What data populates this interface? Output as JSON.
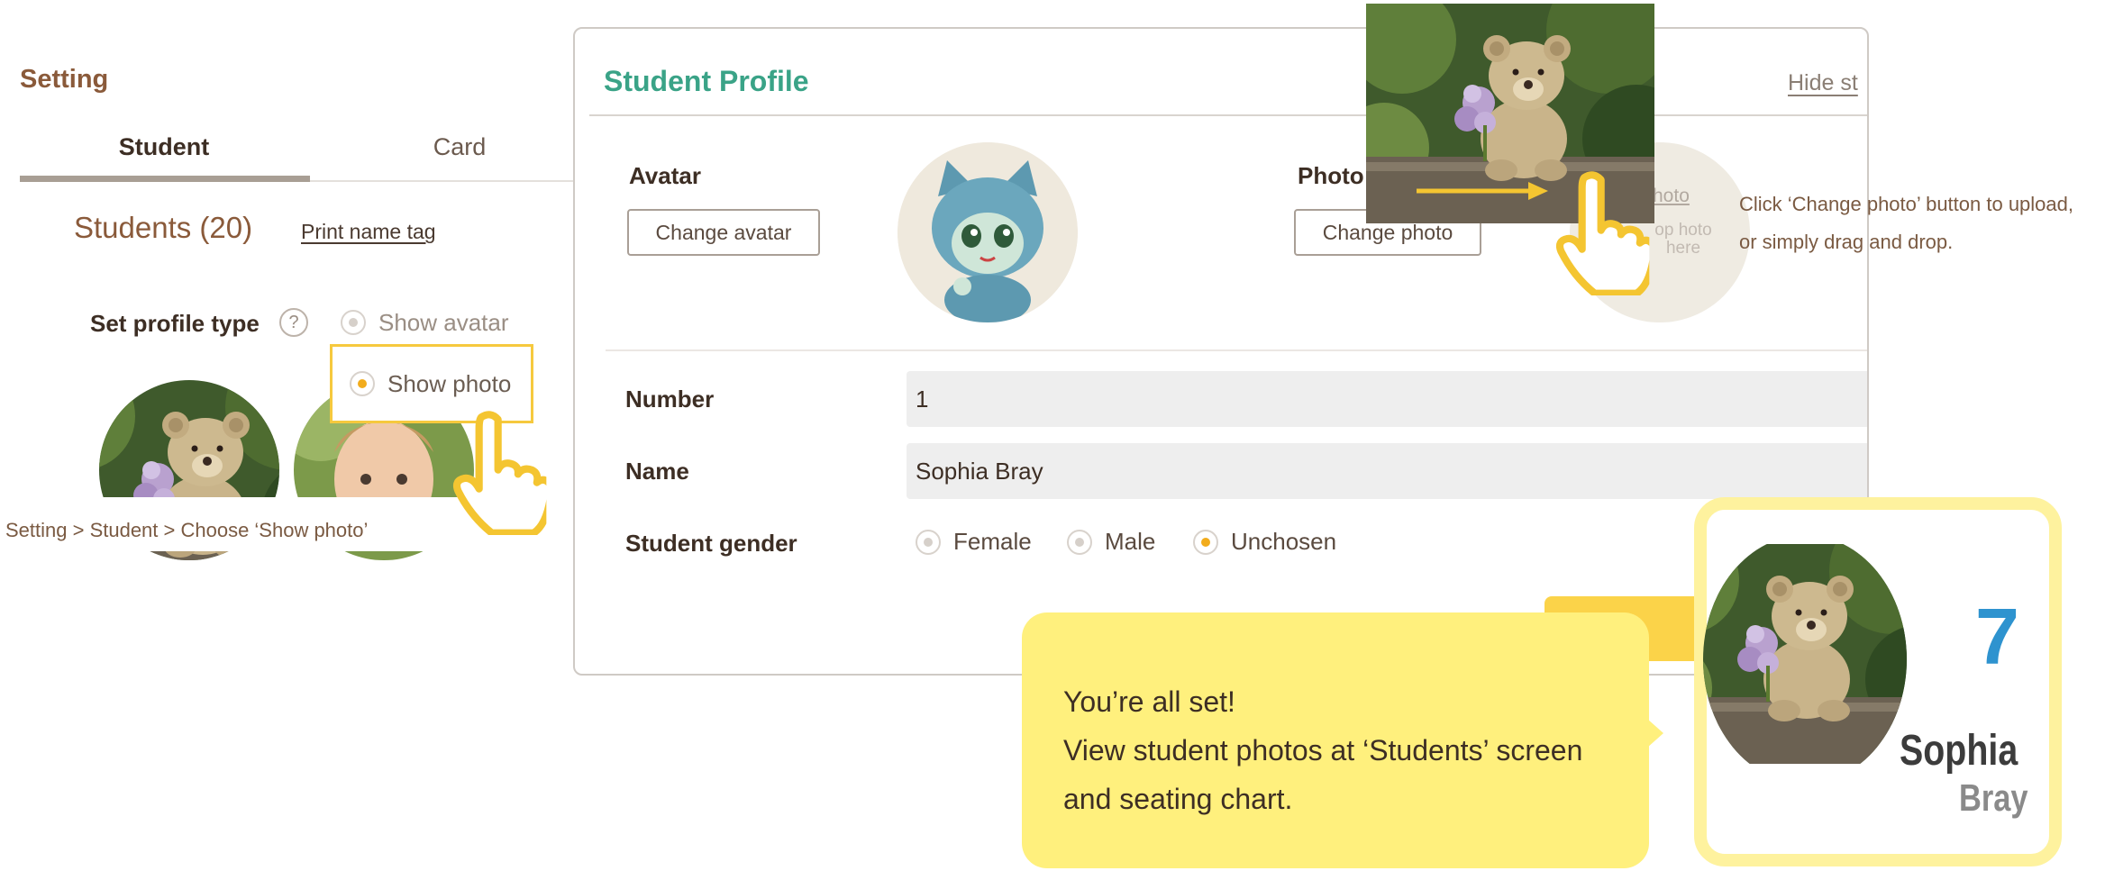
{
  "settings": {
    "title": "Setting",
    "tabs": [
      {
        "label": "Student",
        "active": true
      },
      {
        "label": "Card",
        "active": false
      }
    ],
    "students_heading": "Students (20)",
    "print_name_tag": "Print name tag",
    "profile_type_label": "Set profile type",
    "help_glyph": "?",
    "profile_options": [
      {
        "label": "Show avatar",
        "selected": false
      },
      {
        "label": "Show photo",
        "selected": true
      }
    ],
    "caption": "Setting > Student > Choose ‘Show photo’"
  },
  "modal": {
    "title": "Student Profile",
    "hide_link": "Hide st",
    "avatar_label": "Avatar",
    "change_avatar": "Change avatar",
    "photo_label": "Photo",
    "change_photo": "Change photo",
    "drop_zone_title": "hoto",
    "drop_zone_text": "op hoto here",
    "number_label": "Number",
    "number_value": "1",
    "name_label": "Name",
    "name_value": "Sophia Bray",
    "gender_label": "Student gender",
    "gender_options": [
      {
        "label": "Female",
        "selected": false
      },
      {
        "label": "Male",
        "selected": false
      },
      {
        "label": "Unchosen",
        "selected": true
      }
    ]
  },
  "upload_caption": {
    "line1": "Click ‘Change photo’ button to upload,",
    "line2": "or simply drag and drop."
  },
  "callout": {
    "line1": "You’re all set!",
    "line2": "View student photos at ‘Students’ screen",
    "line3": "and seating chart."
  },
  "card": {
    "number": "7",
    "first_name": "Sophia",
    "last_name": "Bray"
  },
  "colors": {
    "accent_yellow": "#f6c93e",
    "radio_selected": "#f2ac1c",
    "title_green": "#3aa387",
    "card_number_blue": "#2e93cf",
    "callout_bg": "#fff07d"
  }
}
